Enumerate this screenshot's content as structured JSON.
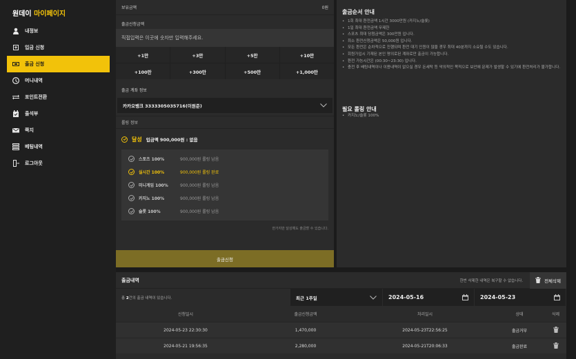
{
  "brand": {
    "prefix": "원데이",
    "highlight": "마이페이지"
  },
  "sidebar": {
    "items": [
      {
        "label": "내정보",
        "icon": "user-icon"
      },
      {
        "label": "입금 신청",
        "icon": "deposit-icon"
      },
      {
        "label": "출금 신청",
        "icon": "withdraw-icon",
        "active": true
      },
      {
        "label": "머니내역",
        "icon": "clock-icon"
      },
      {
        "label": "포인트전환",
        "icon": "exchange-icon"
      },
      {
        "label": "출석부",
        "icon": "calendar-icon"
      },
      {
        "label": "쪽지",
        "icon": "mail-icon"
      },
      {
        "label": "베팅내역",
        "icon": "list-icon"
      },
      {
        "label": "로그아웃",
        "icon": "logout-icon"
      }
    ]
  },
  "withdraw": {
    "holding_label": "보유금액",
    "holding_value": "0원",
    "amount_title": "출금신청금액",
    "amount_placeholder": "직접입력은 이곳에 숫자만 입력해주세요.",
    "quick_buttons": [
      "+1만",
      "+3만",
      "+5만",
      "+10만",
      "+100만",
      "+300만",
      "+500만",
      "+1,000만"
    ],
    "account_title": "출금 계좌 정보",
    "account_value": "카카오뱅크 3333305035716(이원준)",
    "rolling_title": "롤링 정보",
    "achieved_label": "달성",
    "achieved_detail": "입금액 900,000원 : 없음",
    "rolling_items": [
      {
        "name": "스포츠 100%",
        "detail": "900,000원 롤링 남음"
      },
      {
        "name": "실시간 100%",
        "detail": "900,000원 롤링 완료",
        "done": true
      },
      {
        "name": "미니게임 100%",
        "detail": "900,000원 롤링 남음"
      },
      {
        "name": "카지노 100%",
        "detail": "900,000원 롤링 남음"
      },
      {
        "name": "슬롯 100%",
        "detail": "900,000원 롤링 남음"
      }
    ],
    "note": "한가지만 달성해도 출금할 수 있습니다.",
    "apply_label": "출금신청"
  },
  "guide": {
    "title": "출금순서 안내",
    "items": [
      "1회 최대 환전금액 1시간 3000만원 (카지노/슬롯)",
      "1일 최대 환전금액 무제한",
      "스포츠 최대 당첨금액은 300만원 입니다.",
      "최소 환전신청금액은 50,000원 입니다.",
      "모든 환전은 순차적으로 진행되며 환전 대기 인원이 많을 경우 최대 40분까지 소요될 수도 있습니다.",
      "회원가입시 기재된 본인 명의로된 계좌로만 출금이 가능합니다.",
      "환전 가능시간은 (00:30~23:30) 입니다.",
      "충전 후 배팅내역이나 이용내역이 없으실 경우 돈세탁 등 악의적인 목적으로 보안에 문제가 발생할 수 있기에 환전처리가 불가합니다."
    ],
    "rolling_title": "필요 롤링 안내",
    "rolling_items": [
      "카지노/슬롯 100%"
    ]
  },
  "history": {
    "title": "출금내역",
    "delete_notice": "한번 삭제한 내역은 복구할 수 없습니다.",
    "delete_all_label": "전체삭제",
    "count_prefix": "총 ",
    "count": "2",
    "count_suffix": "건의 출금 내역이 있습니다.",
    "period": "최근 1주일",
    "date_from": "2024-05-16",
    "date_to": "2024-05-23",
    "columns": [
      "신청일시",
      "출금신청금액",
      "처리일시",
      "상태",
      "삭제"
    ],
    "rows": [
      {
        "requested": "2024-05-23 22:30:30",
        "amount": "1,470,000",
        "processed": "2024-05-23T22:56:25",
        "status": "출금거부"
      },
      {
        "requested": "2024-05-21 19:56:35",
        "amount": "2,280,000",
        "processed": "2024-05-21T20:06:33",
        "status": "출금완료"
      }
    ]
  },
  "colors": {
    "accent": "#f2c20a",
    "apply_button": "#7c6d25"
  }
}
